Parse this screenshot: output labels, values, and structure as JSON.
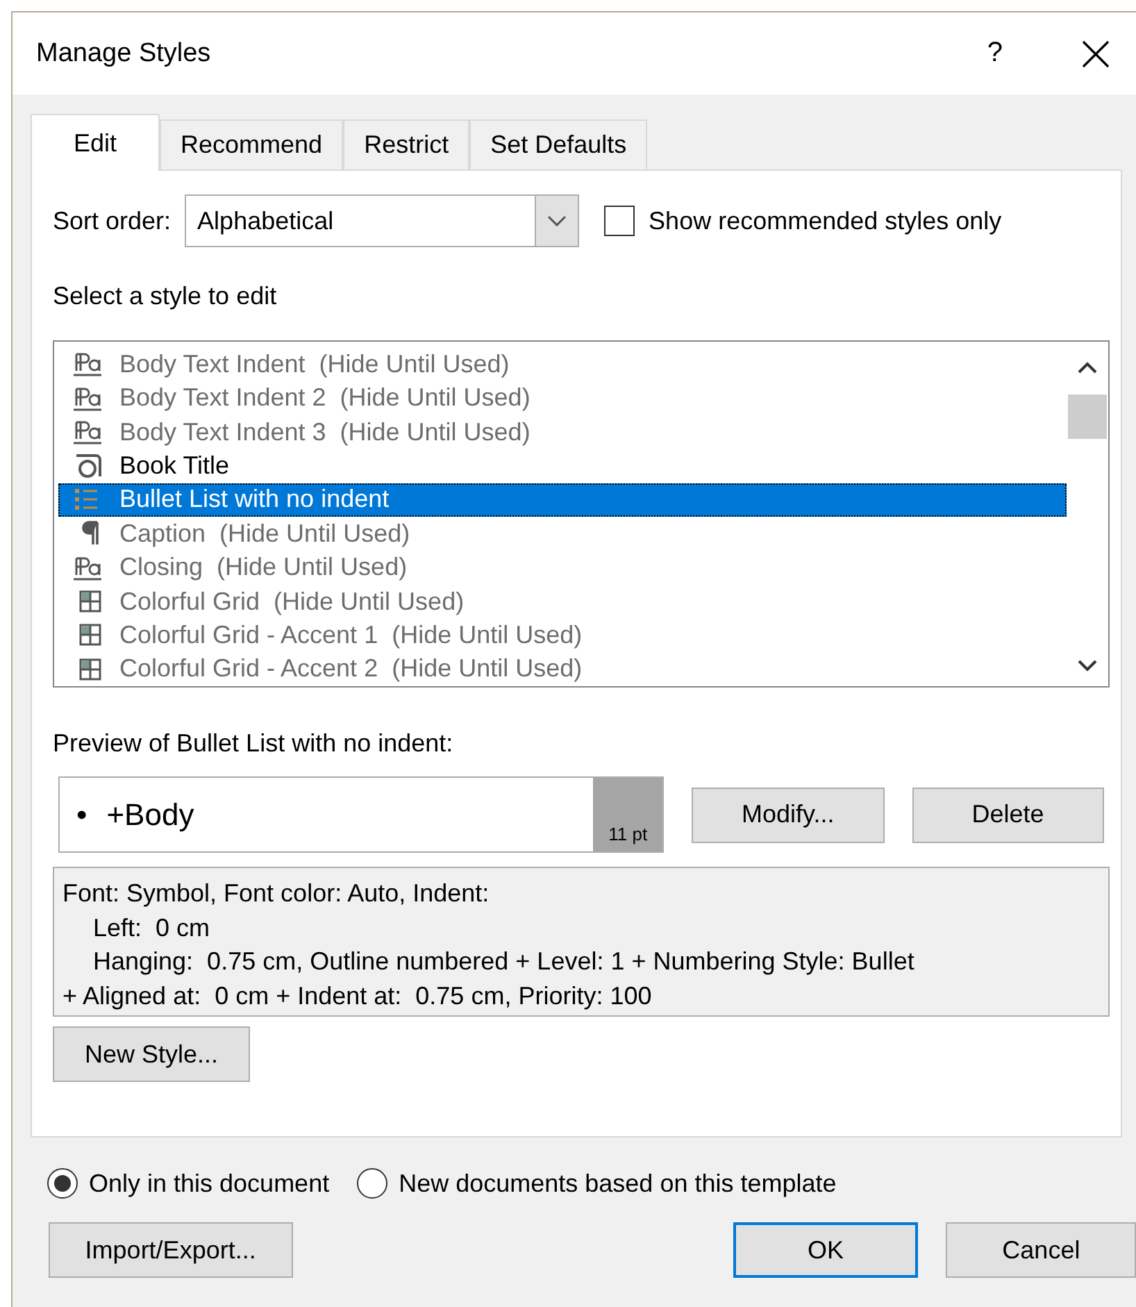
{
  "window": {
    "title": "Manage Styles",
    "help": "?"
  },
  "tabs": [
    {
      "label": "Edit",
      "selected": true
    },
    {
      "label": "Recommend",
      "selected": false
    },
    {
      "label": "Restrict",
      "selected": false
    },
    {
      "label": "Set Defaults",
      "selected": false
    }
  ],
  "sort_order": {
    "label": "Sort order:",
    "value": "Alphabetical"
  },
  "show_recommended": {
    "label": "Show recommended styles only",
    "checked": false
  },
  "list_label": "Select a style to edit",
  "styles": [
    {
      "kind": "linked",
      "name": "Body Text Indent  (Hide Until Used)",
      "hidden": true,
      "selected": false
    },
    {
      "kind": "linked",
      "name": "Body Text Indent 2  (Hide Until Used)",
      "hidden": true,
      "selected": false
    },
    {
      "kind": "linked",
      "name": "Body Text Indent 3  (Hide Until Used)",
      "hidden": true,
      "selected": false
    },
    {
      "kind": "character",
      "name": "Book Title",
      "hidden": false,
      "selected": false
    },
    {
      "kind": "list",
      "name": "Bullet List with no indent",
      "hidden": false,
      "selected": true
    },
    {
      "kind": "paragraph",
      "name": "Caption  (Hide Until Used)",
      "hidden": true,
      "selected": false
    },
    {
      "kind": "linked",
      "name": "Closing  (Hide Until Used)",
      "hidden": true,
      "selected": false
    },
    {
      "kind": "table",
      "name": "Colorful Grid  (Hide Until Used)",
      "hidden": true,
      "selected": false
    },
    {
      "kind": "table",
      "name": "Colorful Grid - Accent 1  (Hide Until Used)",
      "hidden": true,
      "selected": false
    },
    {
      "kind": "table",
      "name": "Colorful Grid - Accent 2  (Hide Until Used)",
      "hidden": true,
      "selected": false
    }
  ],
  "preview": {
    "label": "Preview of Bullet List with no indent:",
    "bullet": "•",
    "text": "+Body",
    "size": "11 pt"
  },
  "buttons_edit": [
    "Modify...",
    "Delete"
  ],
  "description": [
    "Font: Symbol, Font color: Auto, Indent:",
    "Left:  0 cm",
    "Hanging:  0.75 cm, Outline numbered + Level: 1 + Numbering Style: Bullet",
    "+ Aligned at:  0 cm + Indent at:  0.75 cm, Priority: 100"
  ],
  "new_style_button": "New Style...",
  "scope": [
    {
      "label": "Only in this document",
      "selected": true
    },
    {
      "label": "New documents based on this template",
      "selected": false
    }
  ],
  "footer_buttons": [
    {
      "label": "Import/Export...",
      "default": false
    },
    {
      "label": "OK",
      "default": true
    },
    {
      "label": "Cancel",
      "default": false
    }
  ]
}
